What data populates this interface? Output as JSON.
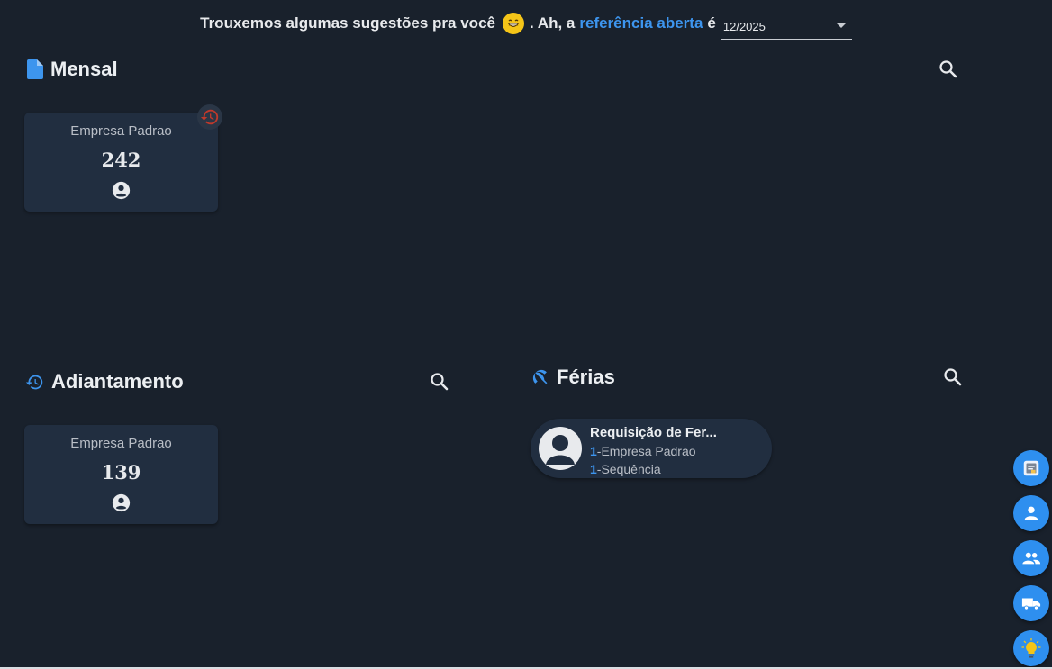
{
  "header": {
    "text_before": "Trouxemos algumas sugestões pra você",
    "text_middle": ". Ah, a",
    "link_text": "referência aberta",
    "text_after": "é",
    "reference_value": "12/2025"
  },
  "sections": {
    "mensal": {
      "title": "Mensal",
      "icon": "document-icon",
      "card": {
        "company": "Empresa Padrao",
        "count": "242"
      }
    },
    "adiantamento": {
      "title": "Adiantamento",
      "icon": "history-icon",
      "card": {
        "company": "Empresa Padrao",
        "count": "139"
      }
    },
    "ferias": {
      "title": "Férias",
      "icon": "beach-umbrella-icon",
      "card": {
        "title": "Requisição de Fer...",
        "company_num": "1",
        "company_label": "-Empresa Padrao",
        "seq_num": "1",
        "seq_label": "-Sequência"
      }
    }
  },
  "fabs": [
    "report-icon",
    "person-icon",
    "people-icon",
    "truck-icon",
    "lightbulb-icon"
  ],
  "colors": {
    "background": "#19212c",
    "card": "#212e40",
    "accent": "#3d95ee",
    "fab": "#2e8fef",
    "history_badge": "#c0392b"
  }
}
